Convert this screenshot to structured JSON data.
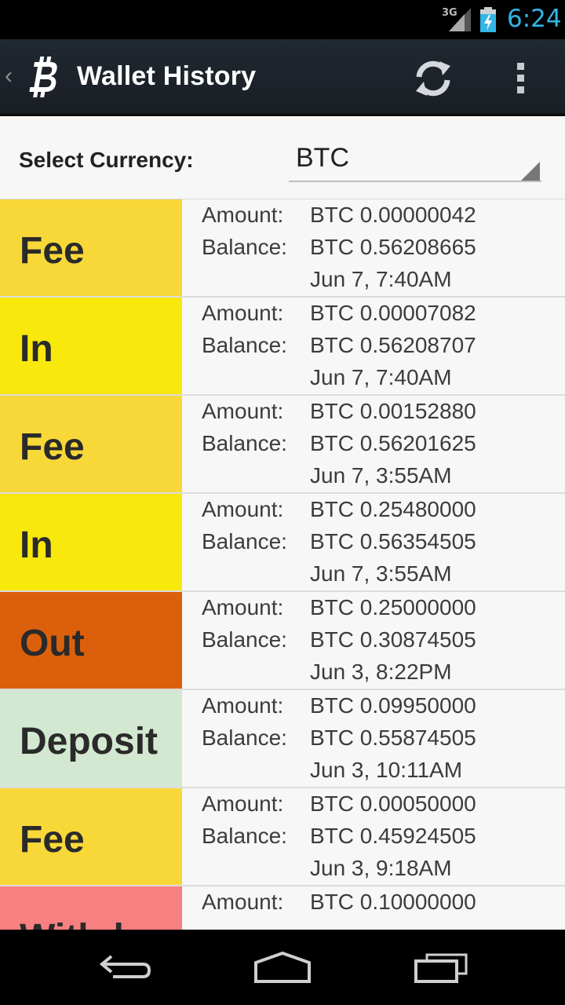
{
  "status_bar": {
    "network": "3G",
    "time": "6:24",
    "time_color": "#33b5e5",
    "icons": [
      "signal-icon",
      "battery-charging-icon"
    ]
  },
  "action_bar": {
    "title": "Wallet History",
    "up_caret": "‹",
    "icons": [
      "bitcoin-logo-icon",
      "refresh-icon",
      "overflow-menu-icon"
    ]
  },
  "currency": {
    "label": "Select Currency:",
    "selected": "BTC"
  },
  "labels": {
    "amount": "Amount:",
    "balance": "Balance:"
  },
  "transactions": [
    {
      "type": "Fee",
      "color": "#f8d838",
      "amount": "BTC 0.00000042",
      "balance": "BTC 0.56208665",
      "date": "Jun 7, 7:40AM"
    },
    {
      "type": "In",
      "color": "#f8e80c",
      "amount": "BTC 0.00007082",
      "balance": "BTC 0.56208707",
      "date": "Jun 7, 7:40AM"
    },
    {
      "type": "Fee",
      "color": "#f8d838",
      "amount": "BTC 0.00152880",
      "balance": "BTC 0.56201625",
      "date": "Jun 7, 3:55AM"
    },
    {
      "type": "In",
      "color": "#f8e80c",
      "amount": "BTC 0.25480000",
      "balance": "BTC 0.56354505",
      "date": "Jun 7, 3:55AM"
    },
    {
      "type": "Out",
      "color": "#dc600c",
      "amount": "BTC 0.25000000",
      "balance": "BTC 0.30874505",
      "date": "Jun 3, 8:22PM"
    },
    {
      "type": "Deposit",
      "color": "#d3e8d0",
      "amount": "BTC 0.09950000",
      "balance": "BTC 0.55874505",
      "date": "Jun 3, 10:11AM"
    },
    {
      "type": "Fee",
      "color": "#f8d838",
      "amount": "BTC 0.00050000",
      "balance": "BTC 0.45924505",
      "date": "Jun 3, 9:18AM"
    },
    {
      "type": "Withdra",
      "color": "#f88080",
      "amount": "BTC 0.10000000",
      "balance": "",
      "date": ""
    }
  ],
  "nav_bar": {
    "icons": [
      "back-icon",
      "home-icon",
      "recent-apps-icon"
    ]
  }
}
